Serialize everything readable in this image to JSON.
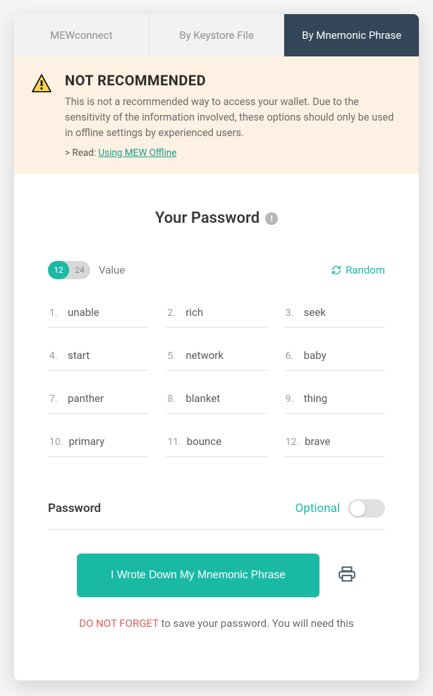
{
  "tabs": [
    {
      "label": "MEWconnect",
      "active": false
    },
    {
      "label": "By Keystore File",
      "active": false
    },
    {
      "label": "By Mnemonic Phrase",
      "active": true
    }
  ],
  "warning": {
    "title": "NOT RECOMMENDED",
    "body": "This is not a recommended way to access your wallet. Due to the sensitivity of the information involved, these options should only be used in offline settings by experienced users.",
    "read_prefix": "> Read: ",
    "read_link": "Using MEW Offline"
  },
  "heading": "Your Password",
  "pill": {
    "opt1": "12",
    "opt2": "24",
    "active": "12"
  },
  "value_label": "Value",
  "random_label": "Random",
  "words": [
    {
      "n": "1.",
      "w": "unable"
    },
    {
      "n": "2.",
      "w": "rich"
    },
    {
      "n": "3.",
      "w": "seek"
    },
    {
      "n": "4.",
      "w": "start"
    },
    {
      "n": "5.",
      "w": "network"
    },
    {
      "n": "6.",
      "w": "baby"
    },
    {
      "n": "7.",
      "w": "panther"
    },
    {
      "n": "8.",
      "w": "blanket"
    },
    {
      "n": "9.",
      "w": "thing"
    },
    {
      "n": "10.",
      "w": "primary"
    },
    {
      "n": "11.",
      "w": "bounce"
    },
    {
      "n": "12.",
      "w": "brave"
    }
  ],
  "password": {
    "label": "Password",
    "optional": "Optional"
  },
  "primary_button": "I Wrote Down My Mnemonic Phrase",
  "footer": {
    "red": "DO NOT FORGET",
    "rest": " to save your password. You will need this"
  }
}
